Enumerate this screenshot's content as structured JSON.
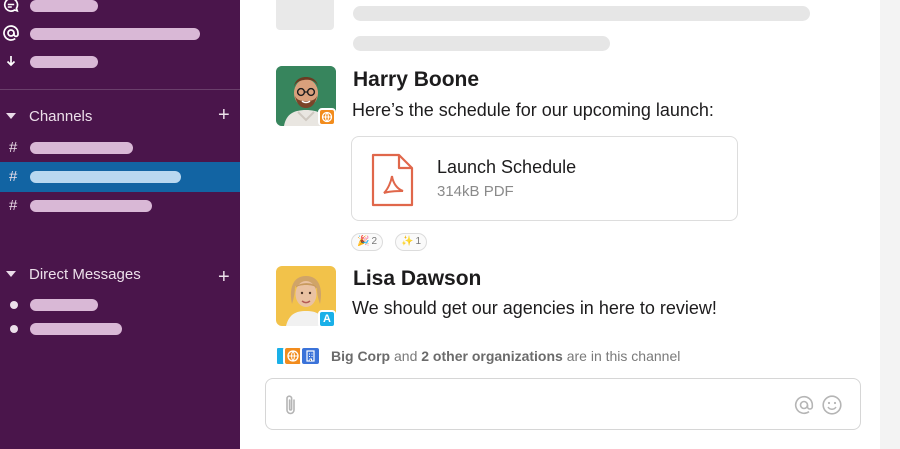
{
  "sidebar": {
    "sections": {
      "channels": {
        "label": "Channels",
        "add": "+"
      },
      "dms": {
        "label": "Direct Messages",
        "add": "+"
      }
    },
    "channel_prefix": "#"
  },
  "messages": [
    {
      "author": "Harry Boone",
      "text": "Here’s the schedule for our upcoming launch:",
      "file": {
        "name": "Launch Schedule",
        "meta": "314kB PDF",
        "icon": "pdf-icon"
      },
      "reactions": [
        {
          "emoji": "🎉",
          "count": "2"
        },
        {
          "emoji": "✨",
          "count": "1"
        }
      ]
    },
    {
      "author": "Lisa Dawson",
      "text": "We should get our agencies in here to review!",
      "badge": "A"
    }
  ],
  "org_notice": {
    "org": "Big Corp",
    "mid": " and ",
    "others": "2 other organizations",
    "tail": " are in this channel"
  },
  "colors": {
    "sidebar": "#4a154b",
    "active_channel": "#1264a3",
    "pdf": "#e0674b"
  }
}
